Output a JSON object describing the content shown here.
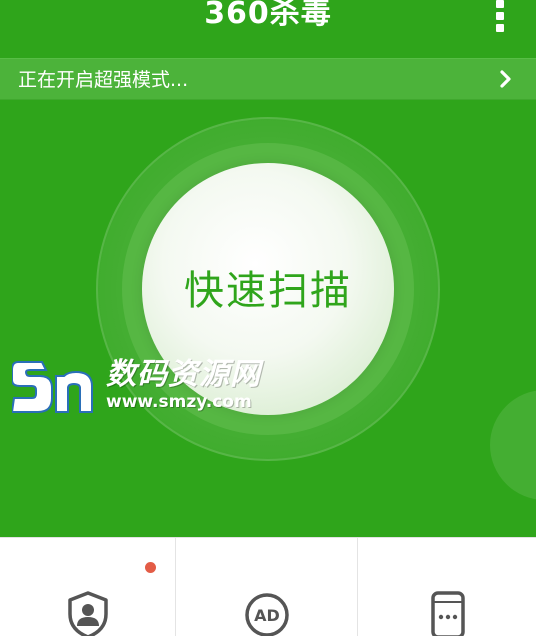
{
  "header": {
    "title": "360杀毒",
    "menu_icon": "more-vertical-icon"
  },
  "status_bar": {
    "text": "正在开启超强模式...",
    "chevron_icon": "chevron-right-icon"
  },
  "scan": {
    "label": "快速扫描"
  },
  "watermark": {
    "logo_text": "数码资源网",
    "url": "www.smzy.com"
  },
  "bottom_nav": {
    "items": [
      {
        "icon": "shield-user-icon",
        "has_badge": true
      },
      {
        "icon": "ad-block-icon"
      },
      {
        "icon": "phone-more-icon"
      }
    ]
  },
  "colors": {
    "brand_green": "#2fa51b",
    "status_green": "#4cb33a",
    "badge_red": "#e35c46",
    "icon_gray": "#555555"
  }
}
